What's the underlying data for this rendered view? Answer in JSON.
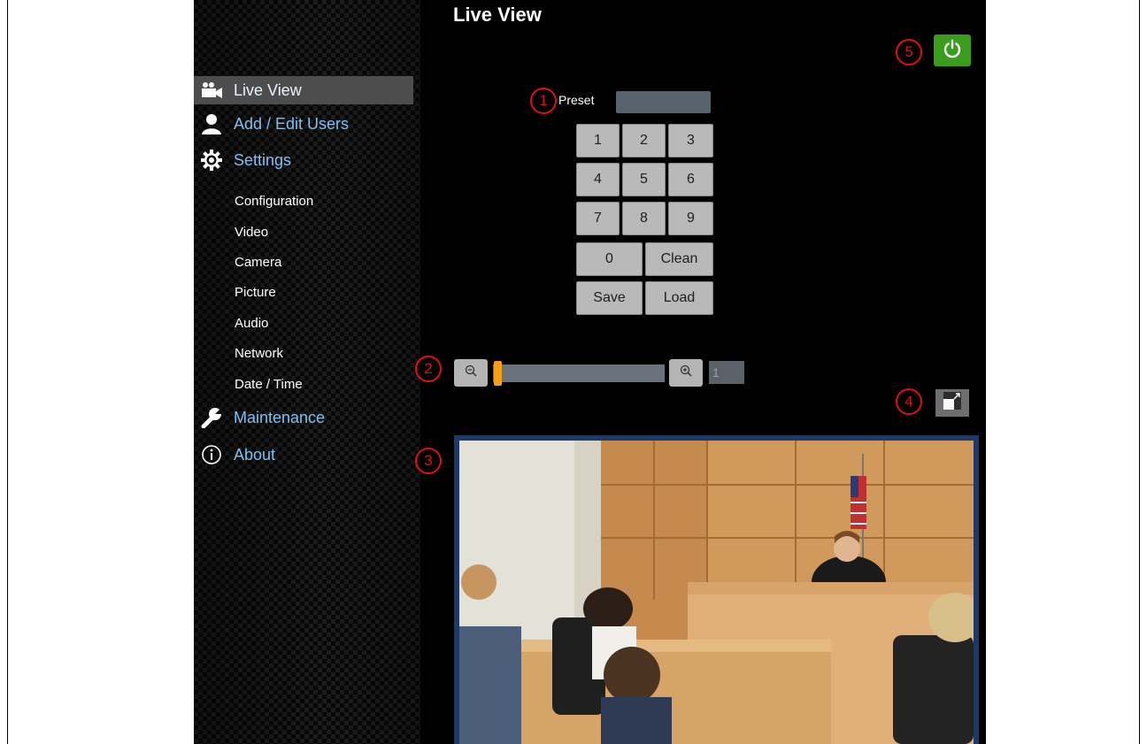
{
  "page": {
    "title": "Live View"
  },
  "sidebar": {
    "items": [
      {
        "label": "Live View"
      },
      {
        "label": "Add / Edit Users"
      },
      {
        "label": "Settings"
      },
      {
        "label": "Maintenance"
      },
      {
        "label": "About"
      }
    ],
    "settings_subitems": [
      {
        "label": "Configuration"
      },
      {
        "label": "Video"
      },
      {
        "label": "Camera"
      },
      {
        "label": "Picture"
      },
      {
        "label": "Audio"
      },
      {
        "label": "Network"
      },
      {
        "label": "Date / Time"
      }
    ]
  },
  "preset": {
    "label": "Preset",
    "value": "",
    "keys": [
      "1",
      "2",
      "3",
      "4",
      "5",
      "6",
      "7",
      "8",
      "9",
      "0",
      "Clean",
      "Save",
      "Load"
    ]
  },
  "zoom": {
    "value": "1",
    "position": 0.0
  },
  "callouts": [
    "1",
    "2",
    "3",
    "4",
    "5"
  ],
  "colors": {
    "power_button": "#3a9d1e",
    "active_nav": "#4d4d4d",
    "nav_text": "#7cc1f3",
    "zoom_thumb": "#f6a018",
    "callout": "#e01010"
  }
}
